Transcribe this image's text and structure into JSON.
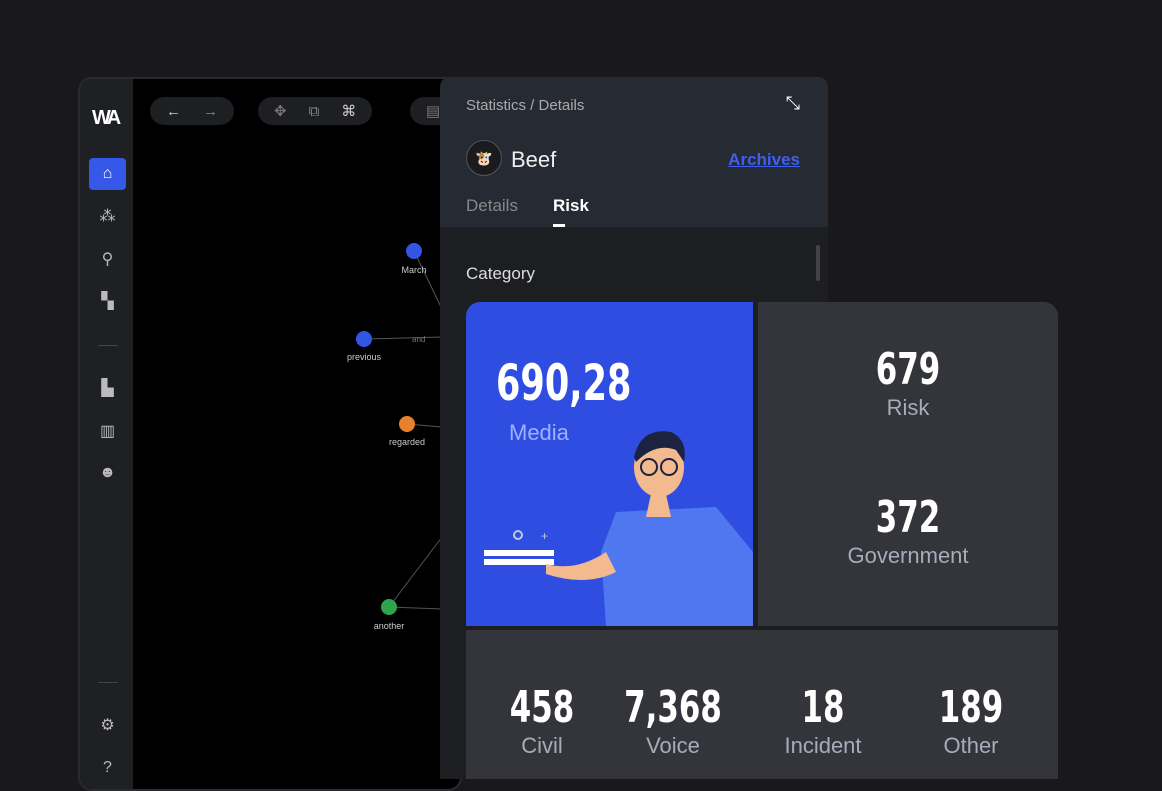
{
  "sidebar": {
    "logo": "WA",
    "items": [
      {
        "icon": "home-icon",
        "active": true
      },
      {
        "icon": "graph-icon"
      },
      {
        "icon": "search-icon"
      },
      {
        "icon": "chat-icon"
      },
      {
        "icon": "dashboard-icon"
      },
      {
        "icon": "map-icon"
      },
      {
        "icon": "user-icon"
      },
      {
        "icon": "gear-icon"
      },
      {
        "icon": "help-icon"
      }
    ]
  },
  "toolbar": {
    "back": "←",
    "forward": "→"
  },
  "graph": {
    "nodes": [
      {
        "label": "March",
        "color": "#3355e6"
      },
      {
        "label": "previous",
        "color": "#3355e6"
      },
      {
        "label": "regarded",
        "color": "#e8822a"
      },
      {
        "label": "another",
        "color": "#2ea44f"
      }
    ],
    "edge_label": "and"
  },
  "panel": {
    "breadcrumb": "Statistics / Details",
    "title": "Beef",
    "archives": "Archives",
    "tabs": [
      {
        "label": "Details",
        "active": false
      },
      {
        "label": "Risk",
        "active": true
      }
    ],
    "section": "Category"
  },
  "stats": {
    "media": {
      "value": "690,28",
      "label": "Media"
    },
    "risk": {
      "value": "679",
      "label": "Risk"
    },
    "government": {
      "value": "372",
      "label": "Government"
    },
    "bottom": [
      {
        "value": "458",
        "label": "Civil"
      },
      {
        "value": "7,368",
        "label": "Voice"
      },
      {
        "value": "18",
        "label": "Incident"
      },
      {
        "value": "189",
        "label": "Other"
      }
    ]
  },
  "colors": {
    "accent": "#3558e8",
    "media_tile": "#2f4de0"
  }
}
